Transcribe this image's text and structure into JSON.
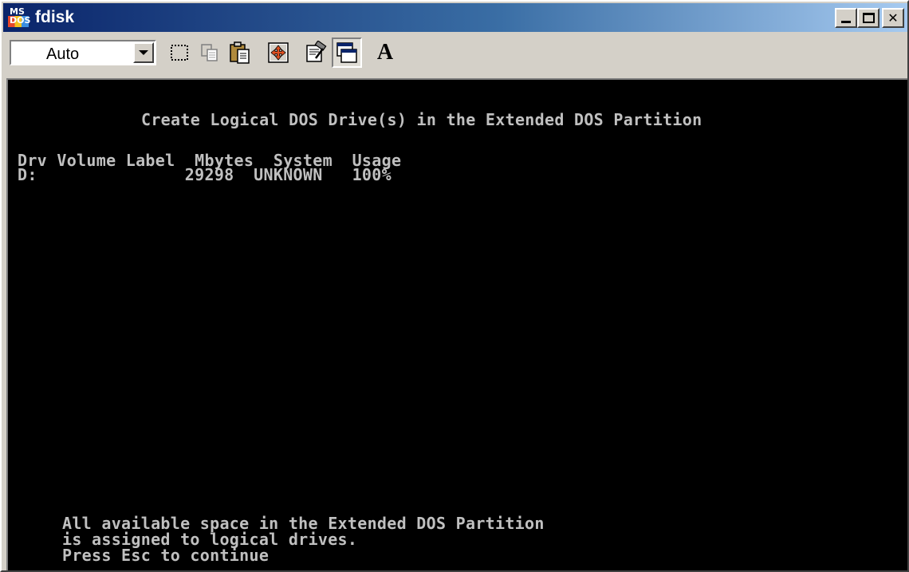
{
  "window": {
    "title": "fdisk",
    "icon": "ms-dos-icon",
    "icon_text_top": "MS",
    "icon_text_bottom": "DOS",
    "buttons": [
      "minimize-icon",
      "maximize-icon",
      "close-icon"
    ],
    "close_glyph": "✕"
  },
  "toolbar": {
    "font_size_value": "Auto",
    "tools": [
      "mark-icon",
      "copy-icon",
      "paste-icon",
      "fullscreen-icon",
      "properties-icon",
      "background-icon",
      "font-icon"
    ],
    "font_glyph": "A"
  },
  "console": {
    "heading": "Create Logical DOS Drive(s) in the Extended DOS Partition",
    "table_header": "Drv Volume Label  Mbytes  System  Usage",
    "rows": [
      "D:               29298  UNKNOWN   100%"
    ],
    "message_line1": "All available space in the Extended DOS Partition",
    "message_line2": "is assigned to logical drives.",
    "prompt": "Press Esc to continue",
    "text_color": "#c0c0c0",
    "background": "#000000"
  },
  "colors": {
    "titlebar_start": "#0a246a",
    "titlebar_end": "#a6caf0",
    "chrome": "#d4d0c8"
  }
}
